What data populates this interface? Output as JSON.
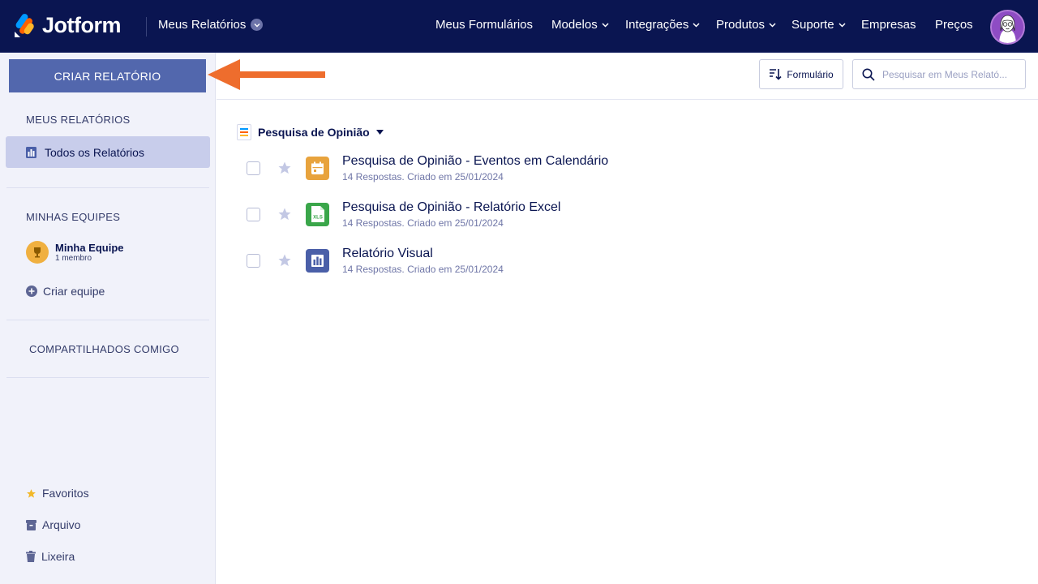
{
  "header": {
    "brand": "Jotform",
    "page_switcher": "Meus Relatórios",
    "nav": [
      {
        "label": "Meus Formulários",
        "has_menu": false
      },
      {
        "label": "Modelos",
        "has_menu": true
      },
      {
        "label": "Integrações",
        "has_menu": true
      },
      {
        "label": "Produtos",
        "has_menu": true
      },
      {
        "label": "Suporte",
        "has_menu": true
      },
      {
        "label": "Empresas",
        "has_menu": false
      },
      {
        "label": "Preços",
        "has_menu": false
      }
    ]
  },
  "sidebar": {
    "create_button": "CRIAR RELATÓRIO",
    "my_reports_title": "MEUS RELATÓRIOS",
    "all_reports": "Todos os Relatórios",
    "teams_title": "MINHAS EQUIPES",
    "team": {
      "name": "Minha Equipe",
      "members": "1 membro"
    },
    "create_team": "Criar equipe",
    "shared_title": "COMPARTILHADOS COMIGO",
    "favorites": "Favoritos",
    "archive": "Arquivo",
    "trash": "Lixeira"
  },
  "toolbar": {
    "sort_label": "Formulário",
    "search_placeholder": "Pesquisar em Meus Relató..."
  },
  "content": {
    "group_title": "Pesquisa de Opinião",
    "reports": [
      {
        "title": "Pesquisa de Opinião - Eventos em Calendário",
        "responses": "14 Respostas.",
        "created": "Criado em 25/01/2024",
        "icon": "calendar-icon",
        "color": "#e8a33d"
      },
      {
        "title": "Pesquisa de Opinião - Relatório Excel",
        "responses": "14 Respostas.",
        "created": "Criado em 25/01/2024",
        "icon": "excel-icon",
        "color": "#3aa64a"
      },
      {
        "title": "Relatório Visual",
        "responses": "14 Respostas.",
        "created": "Criado em 25/01/2024",
        "icon": "bar-chart-icon",
        "color": "#4a5fa8"
      }
    ]
  },
  "colors": {
    "nav_bg": "#0a1551",
    "primary_button": "#5267ad",
    "annotation_arrow": "#ee6d2d"
  }
}
